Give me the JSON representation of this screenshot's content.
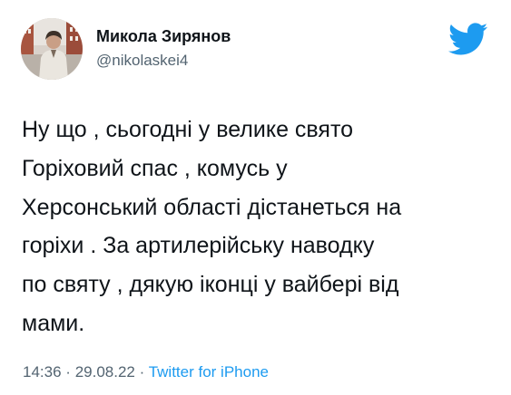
{
  "tweet": {
    "author": {
      "display_name": "Микола Зирянов",
      "handle": "@nikolaskei4",
      "avatar_icon": "profile-photo"
    },
    "brand_icon": "twitter-bird-icon",
    "brand_color": "#1d9bf0",
    "text_lines": [
      "Ну що , сьогодні у велике свято",
      "Горіховий спас , комусь у",
      "Херсонський області дістанеться на",
      "горіхи . За артилерійську наводку",
      "по святу , дякую іконці у вайбері від",
      "мами."
    ],
    "meta": {
      "time": "14:36",
      "separator": "·",
      "date": "29.08.22",
      "source": "Twitter for iPhone"
    }
  }
}
